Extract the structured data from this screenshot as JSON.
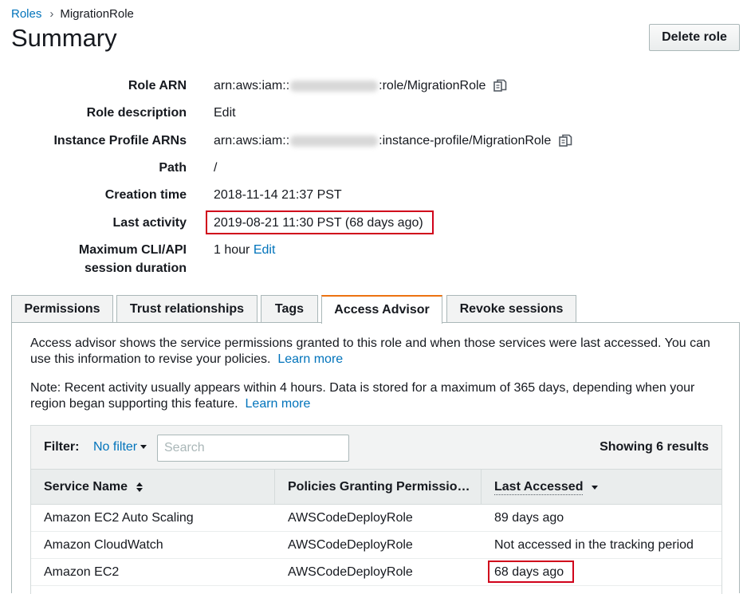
{
  "breadcrumb": {
    "parent": "Roles",
    "current": "MigrationRole"
  },
  "page_title": "Summary",
  "delete_label": "Delete role",
  "summary": {
    "role_arn_label": "Role ARN",
    "role_arn_prefix": "arn:aws:iam::",
    "role_arn_suffix": ":role/MigrationRole",
    "role_description_label": "Role description",
    "role_description_edit": "Edit",
    "instance_profile_label": "Instance Profile ARNs",
    "instance_profile_prefix": "arn:aws:iam::",
    "instance_profile_suffix": ":instance-profile/MigrationRole",
    "path_label": "Path",
    "path_value": "/",
    "creation_time_label": "Creation time",
    "creation_time_value": "2018-11-14 21:37 PST",
    "last_activity_label": "Last activity",
    "last_activity_value": "2019-08-21 11:30 PST (68 days ago)",
    "max_session_label_1": "Maximum CLI/API",
    "max_session_label_2": "session duration",
    "max_session_value": "1 hour",
    "max_session_edit": "Edit"
  },
  "tabs": [
    {
      "label": "Permissions"
    },
    {
      "label": "Trust relationships"
    },
    {
      "label": "Tags"
    },
    {
      "label": "Access Advisor"
    },
    {
      "label": "Revoke sessions"
    }
  ],
  "active_tab": "Access Advisor",
  "advisor": {
    "intro": "Access advisor shows the service permissions granted to this role and when those services were last accessed. You can use this information to revise your policies.",
    "learn_more_1": "Learn more",
    "note": "Note: Recent activity usually appears within 4 hours. Data is stored for a maximum of 365 days, depending when your region began supporting this feature.",
    "learn_more_2": "Learn more"
  },
  "table": {
    "filter_label": "Filter:",
    "filter_value": "No filter",
    "search_placeholder": "Search",
    "showing": "Showing 6 results",
    "columns": [
      "Service Name",
      "Policies Granting Permissio…",
      "Last Accessed"
    ],
    "rows": [
      {
        "service": "Amazon EC2 Auto Scaling",
        "policy": "AWSCodeDeployRole",
        "last_accessed": "89 days ago"
      },
      {
        "service": "Amazon CloudWatch",
        "policy": "AWSCodeDeployRole",
        "last_accessed": "Not accessed in the tracking period"
      },
      {
        "service": "Amazon EC2",
        "policy": "AWSCodeDeployRole",
        "last_accessed": "68 days ago"
      }
    ]
  },
  "colors": {
    "link": "#0073bb",
    "active_tab_accent": "#ec7211",
    "highlight": "#d0021b"
  }
}
